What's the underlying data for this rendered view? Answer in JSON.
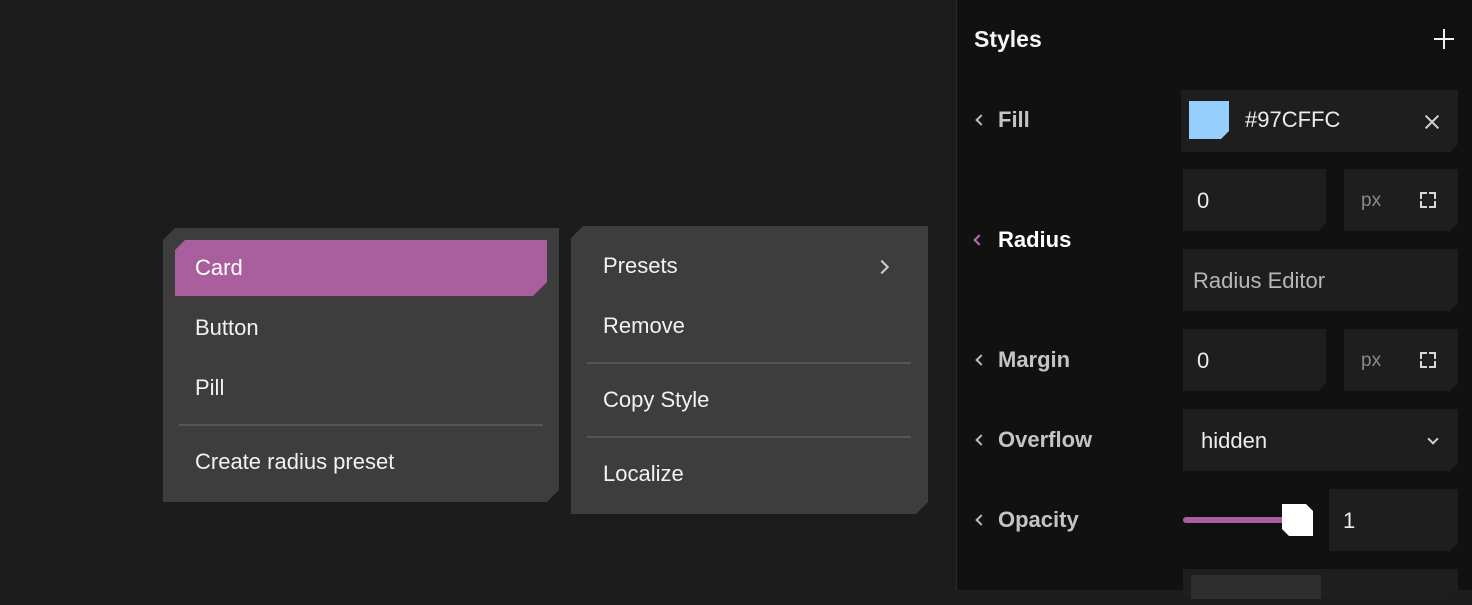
{
  "radius_menu": {
    "items": [
      {
        "label": "Card",
        "selected": true
      },
      {
        "label": "Button",
        "selected": false
      },
      {
        "label": "Pill",
        "selected": false
      }
    ],
    "create_label": "Create radius preset"
  },
  "style_menu": {
    "presets_label": "Presets",
    "remove_label": "Remove",
    "copy_style_label": "Copy Style",
    "localize_label": "Localize"
  },
  "panel": {
    "title": "Styles",
    "add_icon": "plus-icon",
    "fill": {
      "label": "Fill",
      "value": "#97CFFC",
      "swatch_color": "#97CFFC"
    },
    "radius": {
      "label": "Radius",
      "value": "0",
      "unit": "px",
      "editor_placeholder": "Radius Editor"
    },
    "margin": {
      "label": "Margin",
      "value": "0",
      "unit": "px"
    },
    "overflow": {
      "label": "Overflow",
      "value": "hidden"
    },
    "opacity": {
      "label": "Opacity",
      "value": "1",
      "slider_fraction": 1.0
    }
  },
  "colors": {
    "accent": "#A95F9D",
    "menu_bg": "#3D3D3D",
    "panel_bg": "#111111",
    "canvas_bg": "#1C1C1C"
  }
}
